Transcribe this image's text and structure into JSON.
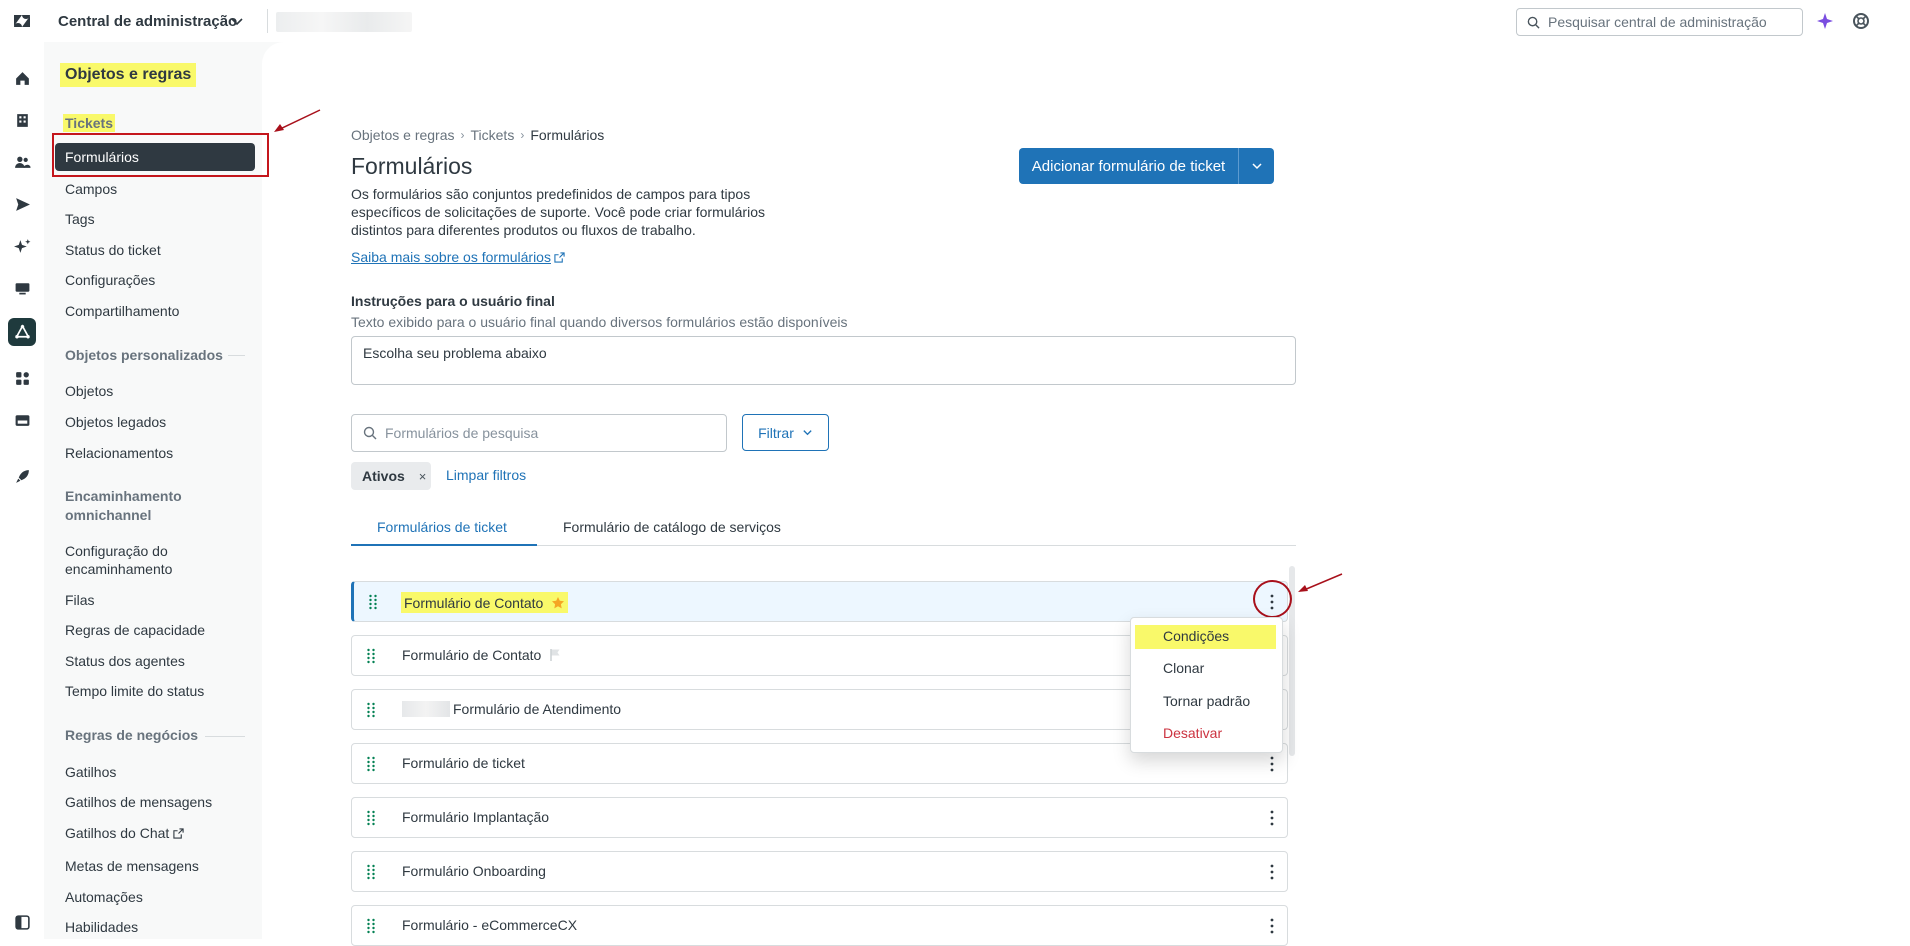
{
  "topbar": {
    "app_title": "Central de administração",
    "search_placeholder": "Pesquisar central de administração"
  },
  "rail": {
    "icons": [
      "home-icon",
      "building-icon",
      "people-icon",
      "send-icon",
      "ai-sparkle-icon",
      "monitor-icon",
      "objects-rules-icon",
      "apps-icon",
      "channels-icon",
      "rocket-icon",
      "panel-toggle-icon"
    ]
  },
  "sidebar": {
    "section_title": "Objetos e regras",
    "groups": {
      "tickets": "Tickets",
      "custom_objects": "Objetos personalizados",
      "routing_line1": "Encaminhamento",
      "routing_line2": "omnichannel",
      "business_rules": "Regras de negócios"
    },
    "tickets_items": [
      "Formulários",
      "Campos",
      "Tags",
      "Status do ticket",
      "Configurações",
      "Compartilhamento"
    ],
    "custom_items": [
      "Objetos",
      "Objetos legados",
      "Relacionamentos"
    ],
    "routing_items": [
      "Configuração do",
      "encaminhamento",
      "Filas",
      "Regras de capacidade",
      "Status dos agentes",
      "Tempo limite do status"
    ],
    "business_items": [
      "Gatilhos",
      "Gatilhos de mensagens",
      "Gatilhos do Chat",
      "Metas de mensagens",
      "Automações",
      "Habilidades"
    ]
  },
  "breadcrumb": [
    "Objetos e regras",
    "Tickets",
    "Formulários"
  ],
  "page": {
    "title": "Formulários",
    "description": "Os formulários são conjuntos predefinidos de campos para tipos específicos de solicitações de suporte. Você pode criar formulários distintos para diferentes produtos ou fluxos de trabalho.",
    "learn_more": "Saiba mais sobre os formulários",
    "add_button": "Adicionar formulário de ticket"
  },
  "instructions": {
    "title": "Instruções para o usuário final",
    "subtitle": "Texto exibido para o usuário final quando diversos formulários estão disponíveis",
    "value": "Escolha seu problema abaixo"
  },
  "filters": {
    "search_placeholder": "Formulários de pesquisa",
    "filter_button": "Filtrar",
    "chip": "Ativos",
    "chip_close": "×",
    "clear": "Limpar filtros"
  },
  "tabs": [
    "Formulários de ticket",
    "Formulário de catálogo de serviços"
  ],
  "forms": [
    {
      "name": "Formulário de Contato",
      "badge": "star-icon",
      "selected": true
    },
    {
      "name": "Formulário de Contato",
      "badge": "flag-icon",
      "selected": false
    },
    {
      "name": "Formulário de Atendimento",
      "badge": "",
      "selected": false
    },
    {
      "name": "Formulário de ticket",
      "badge": "",
      "selected": false
    },
    {
      "name": "Formulário Implantação",
      "badge": "",
      "selected": false
    },
    {
      "name": "Formulário Onboarding",
      "badge": "",
      "selected": false
    },
    {
      "name": "Formulário - eCommerceCX",
      "badge": "",
      "selected": false
    }
  ],
  "row_menu": [
    "Condições",
    "Clonar",
    "Tornar padrão",
    "Desativar"
  ],
  "colors": {
    "brand_blue": "#1f73b7",
    "highlight": "#f9f96a",
    "annotation_red": "#c4161c",
    "danger": "#cc3340"
  }
}
